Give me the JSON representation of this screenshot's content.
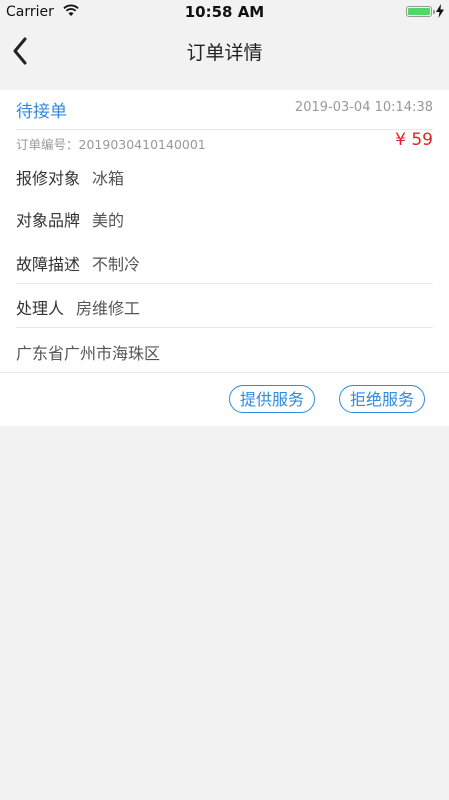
{
  "status_bar": {
    "carrier": "Carrier",
    "time": "10:58 AM",
    "battery_level": 1.0
  },
  "nav": {
    "title": "订单详情",
    "back_icon": "chevron-left-icon"
  },
  "order": {
    "status": "待接单",
    "datetime": "2019-03-04 10:14:38",
    "order_no_label": "订单编号：",
    "order_no": "2019030410140001",
    "price": "¥ 59",
    "repair_object_label": "报修对象",
    "repair_object": "冰箱",
    "brand_label": "对象品牌",
    "brand": "美的",
    "fault_label": "故障描述",
    "fault": "不制冷",
    "handler_label": "处理人",
    "handler": "房维修工",
    "address": "广东省广州市海珠区"
  },
  "actions": {
    "provide_label": "提供服务",
    "reject_label": "拒绝服务"
  },
  "colors": {
    "accent": "#2f8ae0",
    "price": "#e02424",
    "battery": "#4cd964"
  }
}
